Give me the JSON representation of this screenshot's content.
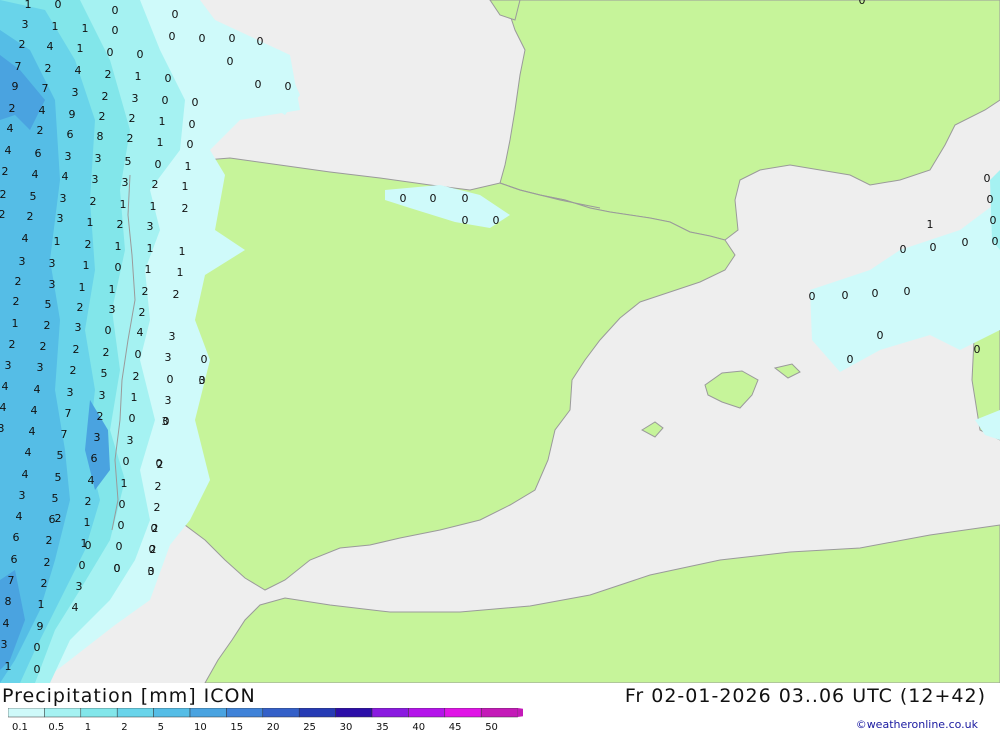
{
  "title": {
    "left": "Precipitation [mm] ICON",
    "right": "Fr 02-01-2026 03..06 UTC (12+42)"
  },
  "credit": "©weatheronline.co.uk",
  "legend": {
    "labels": [
      "0.1",
      "0.5",
      "1",
      "2",
      "5",
      "10",
      "15",
      "20",
      "25",
      "30",
      "35",
      "40",
      "45",
      "50"
    ],
    "colors": [
      "#cffafa",
      "#a5f2f2",
      "#82e6ea",
      "#69d4ea",
      "#55bde6",
      "#4aa3e0",
      "#3f82d8",
      "#3460c8",
      "#263bb4",
      "#2c0ea8",
      "#8a1ae0",
      "#b414ea",
      "#e014e6",
      "#c41ab8"
    ]
  },
  "map": {
    "colors": {
      "sea": "#eeeeee",
      "land": "#c6f49a",
      "border": "#9a9a9a"
    },
    "precip_values": [
      "1",
      "0",
      "0",
      "0",
      "3",
      "1",
      "1",
      "0",
      "0",
      "0",
      "0",
      "0",
      "2",
      "4",
      "1",
      "0",
      "0",
      "0",
      "7",
      "2",
      "4",
      "2",
      "1",
      "0",
      "9",
      "7",
      "3",
      "2",
      "3",
      "0",
      "0",
      "0",
      "0",
      "2",
      "4",
      "9",
      "2",
      "2",
      "1",
      "0",
      "4",
      "2",
      "6",
      "8",
      "2",
      "1",
      "0",
      "4",
      "6",
      "3",
      "3",
      "5",
      "0",
      "1",
      "2",
      "4",
      "4",
      "3",
      "3",
      "2",
      "1",
      "2",
      "5",
      "3",
      "2",
      "1",
      "1",
      "2",
      "2",
      "2",
      "3",
      "1",
      "2",
      "3",
      "4",
      "1",
      "2",
      "1",
      "1",
      "1",
      "3",
      "3",
      "1",
      "0",
      "1",
      "1",
      "2",
      "3",
      "1",
      "1",
      "2",
      "2",
      "2",
      "5",
      "2",
      "3",
      "2",
      "1",
      "2",
      "3",
      "0",
      "4",
      "3",
      "2",
      "2",
      "2",
      "2",
      "0",
      "3",
      "3",
      "3",
      "2",
      "5",
      "2",
      "0",
      "3",
      "4",
      "4",
      "3",
      "3",
      "1",
      "3",
      "4",
      "4",
      "7",
      "2",
      "0",
      "3",
      "3",
      "4",
      "7",
      "3",
      "3",
      "4",
      "5",
      "6",
      "0",
      "2",
      "4",
      "5",
      "4",
      "1",
      "2",
      "3",
      "5",
      "2",
      "0",
      "2",
      "4",
      "6",
      "1",
      "0",
      "2",
      "6",
      "2",
      "1",
      "0",
      "2",
      "6",
      "2",
      "0",
      "0",
      "3",
      "7",
      "2",
      "3",
      "8",
      "1",
      "4",
      "4",
      "9",
      "3",
      "0",
      "1",
      "0",
      "0",
      "0",
      "0",
      "0",
      "0",
      "0",
      "0",
      "0",
      "0",
      "0",
      "1",
      "0",
      "0",
      "0",
      "0",
      "0",
      "0",
      "0",
      "0",
      "0",
      "0",
      "0",
      "0",
      "0",
      "0",
      "0",
      "0",
      "0",
      "0",
      "0",
      "2"
    ]
  }
}
